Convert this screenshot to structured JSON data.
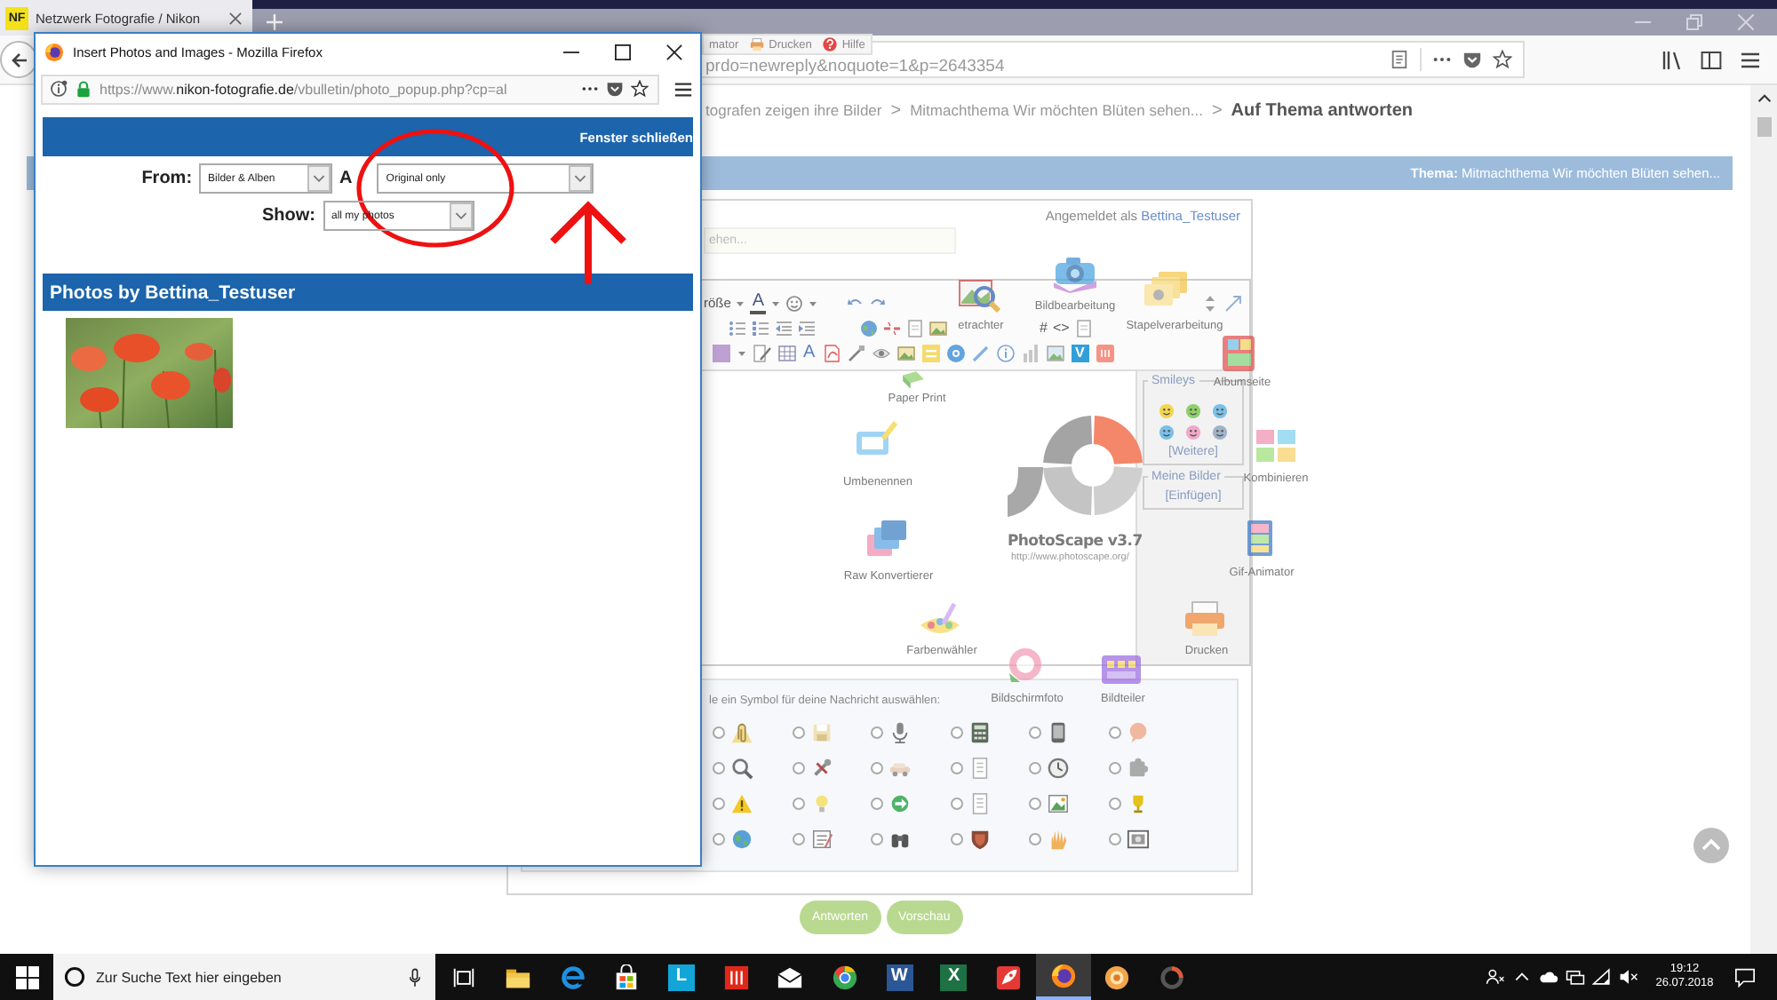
{
  "browser": {
    "tab": {
      "favicon": "NF",
      "title": "Netzwerk Fotografie / Nikon"
    },
    "address": "prdo=newreply&noquote=1&p=2643354",
    "breadcrumb": [
      {
        "label": "tografen zeigen ihre Bilder",
        "current": false
      },
      {
        "separator": ">",
        "label": "Mitmachthema Wir möchten Blüten sehen...",
        "current": false
      },
      {
        "separator": ">",
        "label": "Auf Thema antworten",
        "current": true
      }
    ],
    "thread_bar": "**Thema:** Mitmachthema Wir möchten Blüten sehen...",
    "reply_form": {
      "logged_in": "Angemeldet als",
      "user": "Bettina_Testuser",
      "title_value": "ehen...",
      "toolbar": {
        "font_size": "röße",
        "font_color": "A",
        "hash": "#",
        "code": "<>",
        "text_style": "A",
        "video": "V"
      },
      "smileys": {
        "title": "Smileys",
        "more": "[Weitere]"
      },
      "my_images": {
        "title": "Meine Bilder",
        "insert": "[Einfügen]"
      },
      "post_icon_prompt": "le ein Symbol für deine Nachricht auswählen:",
      "post_icons": [
        {
          "selected": false
        },
        {
          "selected": false
        },
        {
          "selected": false
        },
        {
          "selected": false
        },
        {
          "selected": false
        },
        {
          "selected": false
        },
        {
          "selected": false
        },
        {
          "selected": false
        },
        {
          "selected": false
        },
        {
          "selected": false
        },
        {
          "selected": false
        },
        {
          "selected": false
        },
        {
          "selected": false
        },
        {
          "selected": false
        },
        {
          "selected": false
        },
        {
          "selected": false
        },
        {
          "selected": false
        },
        {
          "selected": false
        },
        {
          "selected": false
        },
        {
          "selected": false
        },
        {
          "selected": false
        },
        {
          "selected": false
        },
        {
          "selected": false
        },
        {
          "selected": false
        }
      ]
    },
    "buttons": [
      {
        "label": "Antworten"
      },
      {
        "label": "Vorschau"
      }
    ]
  },
  "photoscape": {
    "menu": [
      {
        "label": "mator"
      },
      {
        "label": "Drucken"
      },
      {
        "label": "Hilfe"
      }
    ],
    "title": "PhotoScape v3.7",
    "url": "http://www.photoscape.org/",
    "tools": [
      {
        "kind": "editor",
        "label": "Bildbearbeitung"
      },
      {
        "kind": "viewer",
        "label": "etrachter"
      },
      {
        "kind": "batch",
        "label": "Stapelverarbeitung"
      },
      {
        "kind": "page",
        "label": "Albumseite"
      },
      {
        "kind": "paper",
        "label": "Paper Print"
      },
      {
        "kind": "rename",
        "label": "Umbenennen"
      },
      {
        "kind": "combine",
        "label": "Kombinieren"
      },
      {
        "kind": "gif",
        "label": "Gif-Animator"
      },
      {
        "kind": "raw",
        "label": "Raw Konvertierer"
      },
      {
        "kind": "picker",
        "label": "Farbenwähler"
      },
      {
        "kind": "print",
        "label": "Drucken"
      },
      {
        "kind": "screenshot",
        "label": "Bildschirmfoto"
      },
      {
        "kind": "splitter",
        "label": "Bildteiler"
      }
    ]
  },
  "popup": {
    "title": "Insert Photos and Images - Mozilla Firefox",
    "url": {
      "prefix": "https://www.",
      "domain": "nikon-fotografie.de",
      "path": "/vbulletin/photo_popup.php?cp=al"
    },
    "close_link": "Fenster schließen",
    "filters": [
      {
        "label": "From:",
        "value": "Bilder & Alben"
      },
      {
        "label": "A",
        "value": "Original only"
      },
      {
        "label": "Show:",
        "value": "all my photos"
      }
    ],
    "gallery_title": "Photos by Bettina_Testuser"
  },
  "taskbar": {
    "search_placeholder": "Zur Suche Text hier eingeben",
    "apps": [
      {
        "kind": "explorer",
        "active": false
      },
      {
        "kind": "edge",
        "active": false
      },
      {
        "kind": "store",
        "active": false
      },
      {
        "kind": "tile",
        "glyph": "L",
        "active": false
      },
      {
        "kind": "bars",
        "active": false
      },
      {
        "kind": "mail",
        "active": false
      },
      {
        "kind": "chrome",
        "active": false
      },
      {
        "kind": "word",
        "glyph": "W",
        "active": false
      },
      {
        "kind": "excel",
        "glyph": "X",
        "active": false
      },
      {
        "kind": "rocket",
        "active": false
      },
      {
        "kind": "firefox",
        "active": true
      },
      {
        "kind": "photoscape",
        "active": false
      },
      {
        "kind": "ring",
        "active": false
      }
    ],
    "time": "19:12",
    "date": "26.07.2018"
  }
}
